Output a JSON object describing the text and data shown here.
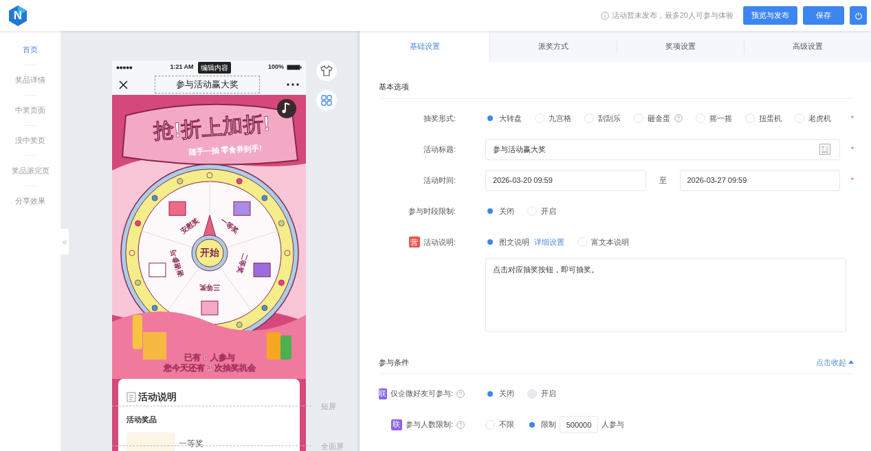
{
  "header": {
    "logo_letter": "N",
    "notice": "活动暂未发布，最多20人可参与体验",
    "buttons": [
      {
        "kind": "text",
        "label": "预览与发布"
      },
      {
        "kind": "text",
        "label": "保存"
      },
      {
        "kind": "power"
      }
    ]
  },
  "sidebar": {
    "items": [
      {
        "label": "首页",
        "selected": true
      },
      {
        "label": "奖品详情",
        "selected": false
      },
      {
        "label": "中奖页面",
        "selected": false
      },
      {
        "label": "没中奖页",
        "selected": false
      },
      {
        "label": "奖品派完页",
        "selected": false
      },
      {
        "label": "分享效果",
        "selected": false
      }
    ]
  },
  "preview": {
    "status": {
      "time": "1:21 AM",
      "tag": "编辑内容",
      "battery": "100%"
    },
    "title": "参与活动赢大奖",
    "poster": {
      "headline": "抢!折上加折!",
      "subline": "随手一抽 零食券到手!",
      "prizes": [
        "一等奖",
        "二等奖",
        "三等奖",
        "谢谢参与",
        "安慰奖"
      ],
      "start_label": "开始",
      "lines": [
        "已有 0 人参与",
        "您今天还有 3 次抽奖机会"
      ]
    },
    "card": {
      "heading": "活动说明",
      "subheading": "活动奖品",
      "prize_name": "一等奖"
    },
    "screen_marks": [
      "短屏",
      "全面屏"
    ],
    "collapse_label": "«"
  },
  "tabs": [
    {
      "label": "基础设置",
      "selected": true
    },
    {
      "label": "派奖方式",
      "selected": false
    },
    {
      "label": "奖项设置",
      "selected": false
    },
    {
      "label": "高级设置",
      "selected": false
    }
  ],
  "sections": [
    {
      "title": "基本选项",
      "rows": [
        {
          "kind": "field",
          "label": "抽奖形式:",
          "required_mark": "*",
          "controls": [
            {
              "kind": "radio",
              "label": "大转盘",
              "selected": true,
              "disabled": false
            },
            {
              "kind": "radio",
              "label": "九宫格",
              "selected": false,
              "disabled": false
            },
            {
              "kind": "radio",
              "label": "刮刮乐",
              "selected": false,
              "disabled": false
            },
            {
              "kind": "radio",
              "label": "砸金蛋",
              "selected": false,
              "disabled": false,
              "help": true
            },
            {
              "kind": "radio",
              "label": "摇一摇",
              "selected": false,
              "disabled": false
            },
            {
              "kind": "radio",
              "label": "扭蛋机",
              "selected": false,
              "disabled": false
            },
            {
              "kind": "radio",
              "label": "老虎机",
              "selected": false,
              "disabled": false
            }
          ]
        },
        {
          "kind": "field",
          "label": "活动标题:",
          "required_mark": "*",
          "controls": [
            {
              "kind": "title-input",
              "value": "参与活动赢大奖"
            }
          ]
        },
        {
          "kind": "field",
          "label": "活动时间:",
          "required_mark": "*",
          "controls": [
            {
              "kind": "input",
              "value": "2026-03-20 09:59"
            },
            {
              "kind": "text",
              "text": "至"
            },
            {
              "kind": "input",
              "value": "2026-03-27 09:59"
            }
          ]
        },
        {
          "kind": "field",
          "label": "参与时段限制:",
          "controls": [
            {
              "kind": "radio",
              "label": "关闭",
              "selected": true,
              "disabled": false
            },
            {
              "kind": "radio",
              "label": "开启",
              "selected": false,
              "disabled": false
            }
          ]
        },
        {
          "kind": "field",
          "label": "活动说明:",
          "badge": {
            "text": "营",
            "color": "#e8574e"
          },
          "controls": [
            {
              "kind": "radio",
              "label": "图文说明",
              "selected": true,
              "disabled": false
            },
            {
              "kind": "link",
              "label": "详细设置"
            },
            {
              "kind": "radio",
              "label": "富文本说明",
              "selected": false,
              "disabled": false
            }
          ]
        },
        {
          "kind": "textarea",
          "value": "点击对应抽奖按钮，即可抽奖。"
        }
      ]
    },
    {
      "title": "参与条件",
      "toggle": "点击收起",
      "rows": [
        {
          "kind": "field",
          "label": "仅企微好友可参与:",
          "help": true,
          "badge": {
            "text": "联",
            "color": "#8c63e6"
          },
          "controls": [
            {
              "kind": "radio",
              "label": "关闭",
              "selected": true,
              "disabled": false
            },
            {
              "kind": "radio",
              "label": "开启",
              "selected": false,
              "disabled": true
            }
          ]
        },
        {
          "kind": "field",
          "label": "参与人数限制:",
          "help": true,
          "badge": {
            "text": "联",
            "color": "#8c63e6"
          },
          "controls": [
            {
              "kind": "radio",
              "label": "不限",
              "selected": false,
              "disabled": false
            },
            {
              "kind": "radio",
              "label": "限制",
              "selected": true,
              "disabled": false
            },
            {
              "kind": "number",
              "value": "500000"
            },
            {
              "kind": "text",
              "text": "人参与"
            }
          ]
        }
      ]
    }
  ]
}
